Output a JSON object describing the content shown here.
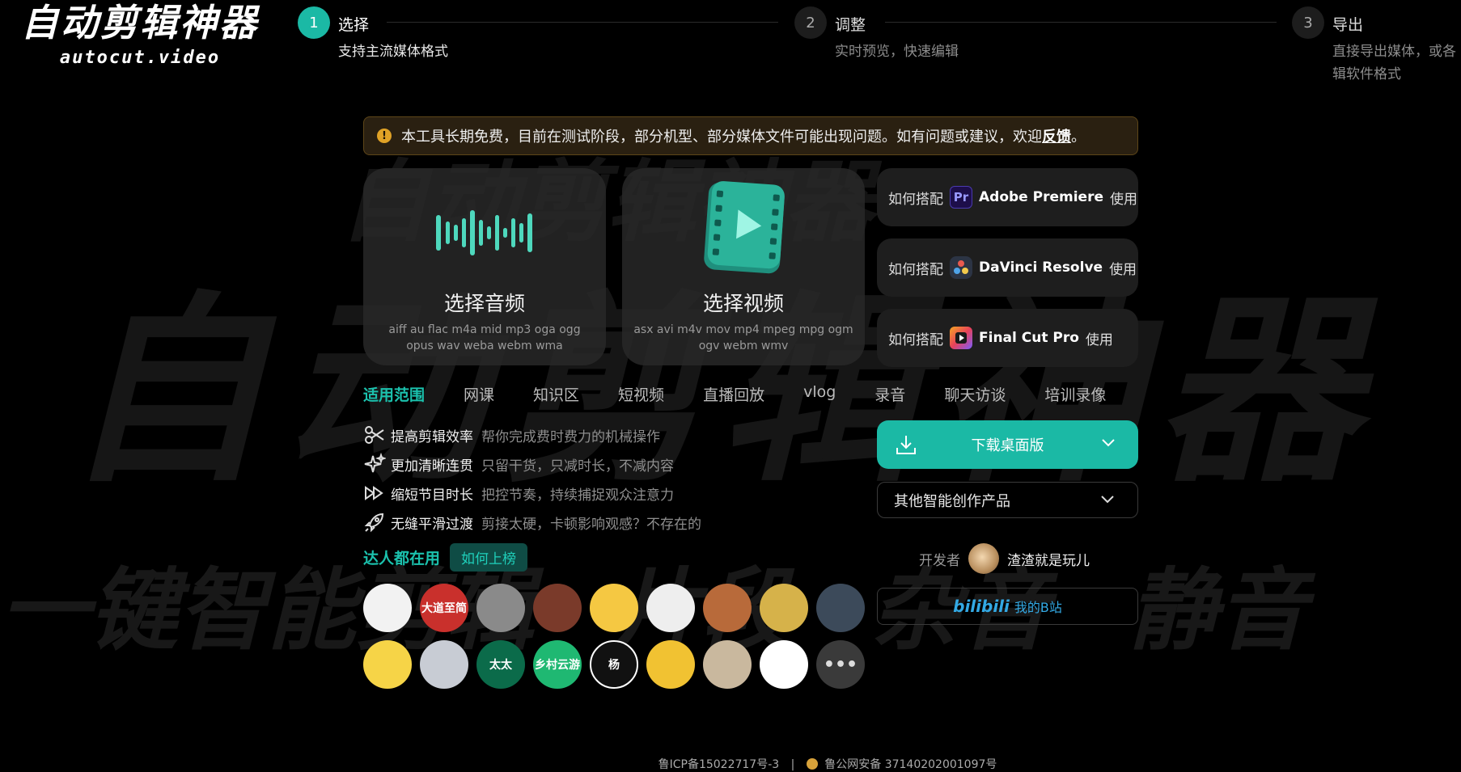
{
  "logo": {
    "title": "自动剪辑神器",
    "subtitle": "autocut.video"
  },
  "background": {
    "big": "自动剪辑神器",
    "top": "自动剪辑神器",
    "row": "一键智能剪辑 片段 杂音 静音"
  },
  "steps": [
    {
      "num": "1",
      "title": "选择",
      "desc": "支持主流媒体格式"
    },
    {
      "num": "2",
      "title": "调整",
      "desc": "实时预览，快速编辑"
    },
    {
      "num": "3",
      "title": "导出",
      "desc": "直接导出媒体，或各辑软件格式"
    }
  ],
  "notice": {
    "text": "本工具长期免费，目前在测试阶段，部分机型、部分媒体文件可能出现问题。如有问题或建议，欢迎",
    "link": "反馈",
    "end": "。"
  },
  "audio_card": {
    "title": "选择音频",
    "formats": "aiff au flac m4a mid mp3 oga ogg opus wav weba webm wma"
  },
  "video_card": {
    "title": "选择视频",
    "formats": "asx avi m4v mov mp4 mpeg mpg ogm ogv webm wmv"
  },
  "howto": [
    {
      "prefix": "如何搭配",
      "app": "Adobe Premiere",
      "suffix": "使用",
      "icon": "premiere-icon"
    },
    {
      "prefix": "如何搭配",
      "app": "DaVinci Resolve",
      "suffix": "使用",
      "icon": "davinci-icon"
    },
    {
      "prefix": "如何搭配",
      "app": "Final Cut Pro",
      "suffix": "使用",
      "icon": "finalcut-icon"
    }
  ],
  "tabs": [
    "适用范围",
    "网课",
    "知识区",
    "短视频",
    "直播回放",
    "vlog",
    "录音",
    "聊天访谈",
    "培训录像"
  ],
  "features": [
    {
      "title": "提高剪辑效率",
      "desc": "帮你完成费时费力的机械操作",
      "icon": "scissors-icon"
    },
    {
      "title": "更加清晰连贯",
      "desc": "只留干货，只减时长，不减内容",
      "icon": "sparkle-icon"
    },
    {
      "title": "缩短节目时长",
      "desc": "把控节奏，持续捕捉观众注意力",
      "icon": "fast-forward-icon"
    },
    {
      "title": "无缝平滑过渡",
      "desc": "剪接太硬，卡顿影响观感？不存在的",
      "icon": "rocket-icon"
    }
  ],
  "download": {
    "label": "下载桌面版"
  },
  "other": {
    "label": "其他智能创作产品"
  },
  "developer": {
    "label": "开发者",
    "name": "渣渣就是玩儿"
  },
  "bili": {
    "logo": "bilibili",
    "label": "我的B站"
  },
  "users": {
    "title": "达人都在用",
    "button": "如何上榜",
    "avatars": [
      {
        "text": "",
        "color": "#f2f2f2"
      },
      {
        "text": "大道至简",
        "color": "#c9302c"
      },
      {
        "text": "",
        "color": "#8a8a8a"
      },
      {
        "text": "",
        "color": "#7a3a2a"
      },
      {
        "text": "",
        "color": "#f5c842"
      },
      {
        "text": "",
        "color": "#eeeeee"
      },
      {
        "text": "",
        "color": "#b86a3a"
      },
      {
        "text": "",
        "color": "#d6b24a"
      },
      {
        "text": "",
        "color": "#3c4a5a"
      },
      {
        "text": "",
        "color": "#f6d447"
      },
      {
        "text": "",
        "color": "#c8ccd4"
      },
      {
        "text": "太太",
        "color": "#0b6b4a"
      },
      {
        "text": "乡村云游",
        "color": "#1fb872"
      },
      {
        "text": "杨",
        "color": "#111111"
      },
      {
        "text": "",
        "color": "#f1c232"
      },
      {
        "text": "",
        "color": "#c9b89e"
      },
      {
        "text": "",
        "color": "#ffffff"
      },
      {
        "text": "•••",
        "color": "#3a3a3a"
      }
    ]
  },
  "footer": {
    "icp": "鲁ICP备15022717号-3",
    "sep": "|",
    "police": "鲁公网安备 37140202001097号"
  },
  "colors": {
    "accent": "#1bb9a5",
    "background": "#000000"
  }
}
